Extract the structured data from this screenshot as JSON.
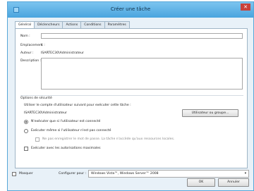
{
  "window": {
    "title": "Créer une tâche",
    "close_glyph": "✕"
  },
  "tabs": [
    {
      "label": "Général",
      "active": true
    },
    {
      "label": "Déclencheurs"
    },
    {
      "label": "Actions"
    },
    {
      "label": "Conditions"
    },
    {
      "label": "Paramètres"
    }
  ],
  "general": {
    "name_label": "Nom :",
    "name_value": "",
    "location_label": "Emplacement :",
    "location_value": "\\",
    "author_label": "Auteur :",
    "author_value": "ISARTEC30\\Administrateur",
    "description_label": "Description :",
    "description_value": ""
  },
  "security": {
    "heading": "Options de sécurité",
    "use_account_text": "Utiliser le compte d'utilisateur suivant pour exécuter cette tâche :",
    "account_value": "ISARTEC30\\Administrateur",
    "change_user_button": "Utilisateur ou groupe...",
    "radio_logged_on": "N'exécuter que si l'utilisateur est connecté",
    "radio_whether": "Exécuter même si l'utilisateur n'est pas connecté",
    "checkbox_no_store": "Ne pas enregistrer le mot de passe. La tâche n'accède qu'aux ressources locales.",
    "checkbox_highest": "Exécuter avec les autorisations maximales"
  },
  "footer": {
    "hidden_label": "Masquer",
    "configure_label": "Configurer pour :",
    "configure_value": "Windows Vista™, Windows Server™ 2008",
    "ok_button": "OK",
    "cancel_button": "Annuler"
  }
}
